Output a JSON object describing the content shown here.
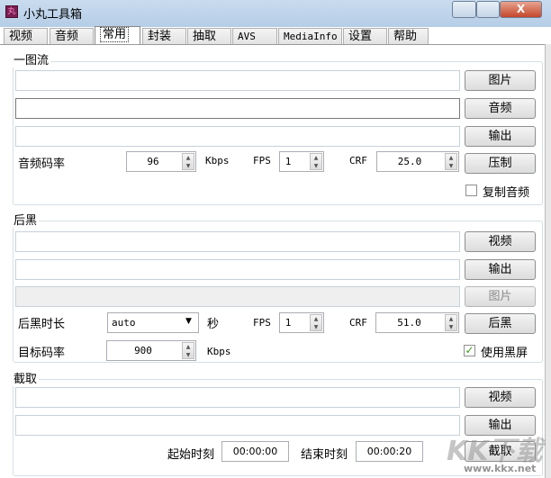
{
  "window": {
    "title": "小丸工具箱",
    "icon": "app-icon",
    "minimize": "minimize-icon",
    "maximize": "maximize-icon",
    "close": "close-icon"
  },
  "tabs": [
    {
      "label": "视频"
    },
    {
      "label": "音频"
    },
    {
      "label": "常用",
      "selected": true
    },
    {
      "label": "封装"
    },
    {
      "label": "抽取"
    },
    {
      "label": "AVS"
    },
    {
      "label": "MediaInfo"
    },
    {
      "label": "设置"
    },
    {
      "label": "帮助"
    }
  ],
  "one_image": {
    "title": "一图流",
    "image_btn": "图片",
    "audio_btn": "音频",
    "output_btn": "输出",
    "audio_bitrate_label": "音频码率",
    "audio_bitrate": "96",
    "kbps": "Kbps",
    "fps_label": "FPS",
    "fps": "1",
    "crf_label": "CRF",
    "crf": "25.0",
    "encode_btn": "压制",
    "copy_audio_label": "复制音频",
    "copy_audio": false
  },
  "black": {
    "title": "后黑",
    "video_btn": "视频",
    "output_btn": "输出",
    "image_btn": "图片",
    "duration_label": "后黑时长",
    "duration": "auto",
    "sec": "秒",
    "fps_label": "FPS",
    "fps": "1",
    "crf_label": "CRF",
    "crf": "51.0",
    "black_btn": "后黑",
    "target_bitrate_label": "目标码率",
    "target_bitrate": "900",
    "kbps": "Kbps",
    "use_black_label": "使用黑屏",
    "use_black": true
  },
  "clip": {
    "title": "截取",
    "video_btn": "视频",
    "output_btn": "输出",
    "start_label": "起始时刻",
    "start": "00:00:00",
    "end_label": "结束时刻",
    "end": "00:00:20",
    "clip_btn": "截取"
  },
  "watermark": {
    "logo": "KK下载",
    "url": "www.kkx.net"
  }
}
